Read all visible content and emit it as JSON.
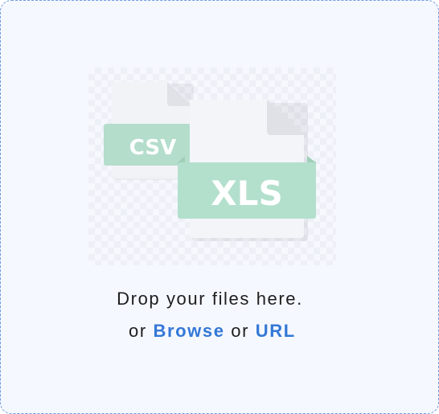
{
  "dropzone": {
    "illustration": {
      "back_file_label": "CSV",
      "front_file_label": "XLS",
      "back_file_icon": "csv-file-icon",
      "front_file_icon": "xls-file-icon"
    },
    "prompt_text": "Drop your files here.",
    "or_text_1": "or",
    "browse_label": "Browse",
    "or_text_2": "or",
    "url_label": "URL",
    "colors": {
      "accent": "#3478d6",
      "border": "#6d9be0",
      "background": "#f5f8ff",
      "file_tag": "#b3e0cd"
    }
  }
}
